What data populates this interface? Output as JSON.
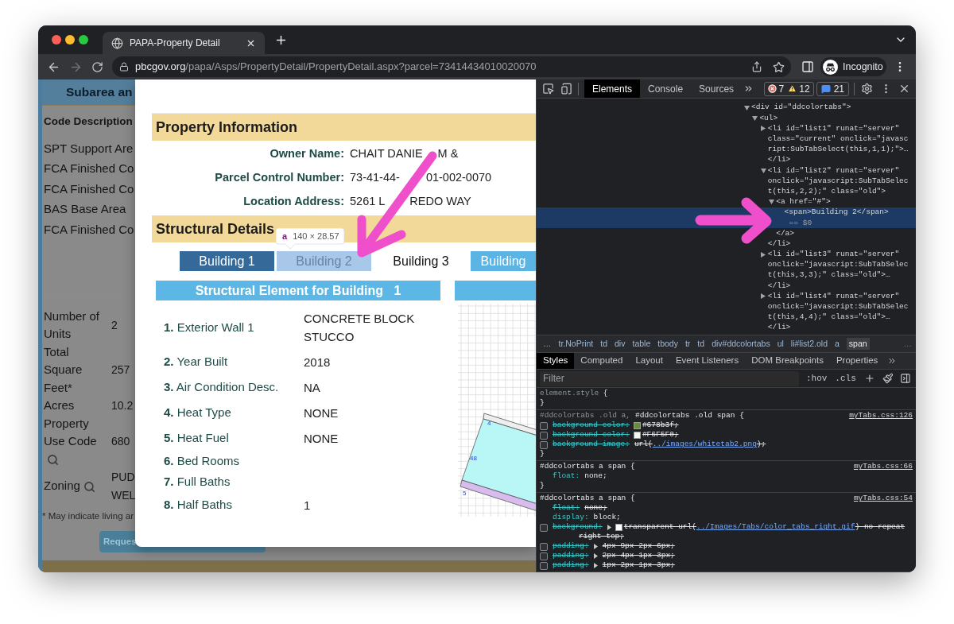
{
  "browser": {
    "tab_title": "PAPA-Property Detail",
    "forward_disabled": true,
    "url_host": "pbcgov.org",
    "url_path": "/papa/Asps/PropertyDetail/PropertyDetail.aspx?parcel=73414434010020070",
    "profile": "Incognito"
  },
  "background_page": {
    "header": "Subarea an",
    "column_header": "Code Description",
    "codes": [
      "SPT Support Are",
      "FCA Finished Co",
      "FCA Finished Co",
      "BAS Base Area",
      "FCA Finished Co"
    ],
    "facts": [
      {
        "label": "Number of Units",
        "value": "2",
        "lookup": false
      },
      {
        "label": "Total Square Feet*",
        "value": "257",
        "lookup": false
      },
      {
        "label": "Acres",
        "value": "10.2",
        "lookup": false
      },
      {
        "label": "Property Use Code",
        "value": "680",
        "lookup": true
      },
      {
        "label": "Zoning",
        "value": "PUD WEL",
        "lookup": true
      }
    ],
    "footnote": "* May indicate living ar",
    "button": "Reques"
  },
  "modal": {
    "property_information": {
      "title": "Property Information",
      "fields": [
        {
          "label": "Owner Name:",
          "value_parts": [
            "CHAIT DANIE",
            "M &"
          ]
        },
        {
          "label": "Parcel Control Number:",
          "value_parts": [
            "73-41-44-",
            "01-002-0070"
          ]
        },
        {
          "label": "Location Address:",
          "value_parts": [
            "5261 L",
            "REDO WAY"
          ]
        }
      ]
    },
    "structural_details": {
      "title": "Structural Details",
      "inspect_tooltip": {
        "tag": "a",
        "size": "140 × 28.57"
      },
      "building_tabs": [
        {
          "label": "Building 1",
          "selected": true,
          "kind": "old"
        },
        {
          "label": "Building 2",
          "selected": false,
          "kind": "inspected"
        },
        {
          "label": "Building 3",
          "selected": false,
          "kind": "plain"
        },
        {
          "label": "Building",
          "selected": false,
          "kind": "old"
        }
      ],
      "element_table": {
        "title": "Structural Element for Building   1",
        "rows": [
          {
            "label": "**1.** Exterior Wall 1",
            "value": "CONCRETE BLOCK STUCCO"
          },
          {
            "label": "**2.** Year Built",
            "value": "2018"
          },
          {
            "label": "**3.** Air Condition Desc.",
            "value": "NA"
          },
          {
            "label": "**4.** Heat Type",
            "value": "NONE"
          },
          {
            "label": "**5.** Heat Fuel",
            "value": "NONE"
          },
          {
            "label": "**6.** Bed Rooms"
          },
          {
            "label": "**7.** Full Baths"
          },
          {
            "label": "**8.** Half Baths",
            "value": "1"
          }
        ]
      },
      "sketch": {
        "labels": [
          "4",
          "48",
          "5"
        ]
      }
    }
  },
  "devtools": {
    "panel_tabs": [
      {
        "label": "Elements",
        "selected": true
      },
      {
        "label": "Console",
        "selected": false
      },
      {
        "label": "Sources",
        "selected": false
      }
    ],
    "issue_counts": {
      "errors": "7",
      "warnings": "12",
      "messages": "21"
    },
    "dom_tree": [
      {
        "lines": [
          "<div id=\"ddcolortabs\">"
        ],
        "kind": "expanded",
        "selected": false,
        "children": [
          {
            "lines": [
              "<ul>"
            ],
            "kind": "expanded",
            "selected": false,
            "children": [
              {
                "lines": [
                  "<li id=\"list1\" runat=\"server\"",
                  "class=\"current\" onclick=\"javasc",
                  "ript:SubTabSelect(this,1,1);\">…"
                ],
                "kind": "collapsed",
                "selected": false,
                "close": "</li>"
              },
              {
                "lines": [
                  "<li id=\"list2\" runat=\"server\"",
                  "onclick=\"javascript:SubTabSelec",
                  "t(this,2,2);\" class=\"old\">"
                ],
                "kind": "expanded",
                "selected": false,
                "children": [
                  {
                    "lines": [
                      "<a href=\"#\">"
                    ],
                    "kind": "expanded",
                    "selected": false,
                    "children": [
                      {
                        "lines": [
                          "<span>Building 2</span>"
                        ],
                        "selected": true,
                        "note": "== $0"
                      }
                    ],
                    "close": "</a>"
                  }
                ],
                "close": "</li>"
              },
              {
                "lines": [
                  "<li id=\"list3\" runat=\"server\"",
                  "onclick=\"javascript:SubTabSelec",
                  "t(this,3,3);\" class=\"old\">…"
                ],
                "kind": "collapsed",
                "selected": false,
                "close": "</li>"
              },
              {
                "lines": [
                  "<li id=\"list4\" runat=\"server\"",
                  "onclick=\"javascript:SubTabSelec",
                  "t(this,4,4);\" class=\"old\">…"
                ],
                "kind": "collapsed",
                "selected": false,
                "close": "</li>"
              }
            ]
          }
        ]
      }
    ],
    "breadcrumbs": {
      "leading": "…",
      "items": [
        {
          "label": "tr.NoPrint",
          "selected": false
        },
        {
          "label": "td",
          "selected": false
        },
        {
          "label": "div",
          "selected": false
        },
        {
          "label": "table",
          "selected": false
        },
        {
          "label": "tbody",
          "selected": false
        },
        {
          "label": "tr",
          "selected": false
        },
        {
          "label": "td",
          "selected": false
        },
        {
          "label": "div#ddcolortabs",
          "selected": false
        },
        {
          "label": "ul",
          "selected": false
        },
        {
          "label": "li#list2.old",
          "selected": false
        },
        {
          "label": "a",
          "selected": false
        },
        {
          "label": "span",
          "selected": true
        }
      ],
      "trailing": "…"
    },
    "sidebar_tabs": [
      {
        "label": "Styles",
        "selected": true
      },
      {
        "label": "Computed",
        "selected": false
      },
      {
        "label": "Layout",
        "selected": false
      },
      {
        "label": "Event Listeners",
        "selected": false
      },
      {
        "label": "DOM Breakpoints",
        "selected": false
      },
      {
        "label": "Properties",
        "selected": false
      }
    ],
    "filter": {
      "placeholder": "Filter"
    },
    "style_actions": [
      ":hov",
      ".cls"
    ],
    "rules": [
      {
        "selector": [
          {
            "text": "element.style",
            "matched": false
          }
        ],
        "open": "{",
        "close": "}"
      },
      {
        "selector": [
          {
            "text": "#ddcolortabs .old a,",
            "matched": false
          },
          {
            "text": "#ddcolortabs .old span",
            "matched": true
          }
        ],
        "open": "{",
        "source": "myTabs.css:126",
        "properties": [
          {
            "kind": "disabled",
            "name": "background-color:",
            "expandable": false,
            "color": "#678b3f",
            "value": "#678b3f;"
          },
          {
            "kind": "disabled",
            "name": "background-color:",
            "expandable": false,
            "color": "#f6f5f0",
            "value": "#F6F5F0;"
          },
          {
            "kind": "disabled",
            "name": "background-image:",
            "expandable": false,
            "value": "url(",
            "link": "../images/whitetab2.png",
            "value_end": ");"
          }
        ],
        "close": "}"
      },
      {
        "selector": [
          {
            "text": "#ddcolortabs a span",
            "matched": true
          }
        ],
        "open": "{",
        "source": "myTabs.css:66",
        "properties": [
          {
            "kind": "active",
            "name": "float:",
            "expandable": false,
            "value": "none;"
          }
        ],
        "close": "}"
      },
      {
        "selector": [
          {
            "text": "#ddcolortabs a span",
            "matched": true
          }
        ],
        "open": "{",
        "source": "myTabs.css:54",
        "properties": [
          {
            "kind": "overridden",
            "name": "float:",
            "expandable": false,
            "value": "none;"
          },
          {
            "kind": "active",
            "name": "display:",
            "expandable": false,
            "value": "block;"
          },
          {
            "kind": "disabled",
            "name": "background:",
            "expandable": true,
            "color": "#ffffff",
            "value": "transparent url(",
            "link": "../Images/Tabs/color_tabs_right.gif",
            "value_end": ") no-repeat",
            "wrap": "right top;"
          },
          {
            "kind": "disabled",
            "name": "padding:",
            "expandable": true,
            "value": "4px 9px 2px 6px;"
          },
          {
            "kind": "disabled",
            "name": "padding:",
            "expandable": true,
            "value": "2px 4px 1px 3px;"
          },
          {
            "kind": "disabled",
            "name": "padding:",
            "expandable": true,
            "value": "1px 2px 1px 3px;"
          }
        ]
      }
    ]
  },
  "annotation_arrows": [
    {
      "kind": "diagonal"
    },
    {
      "kind": "horizontal"
    }
  ]
}
